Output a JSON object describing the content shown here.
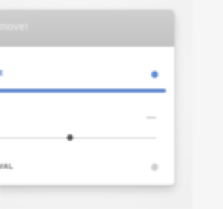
{
  "panel": {
    "title": "move!",
    "tabs": [
      {
        "label": "E",
        "state": "active"
      },
      {
        "label": "VAL",
        "state": "inactive"
      }
    ]
  },
  "slider": {
    "value": 0.46
  },
  "colors": {
    "accent": "#2f66c8",
    "header": "#c8c8c8"
  },
  "icons": {
    "active_row_icon": "info-icon",
    "inactive_row_icon": "info-icon"
  }
}
